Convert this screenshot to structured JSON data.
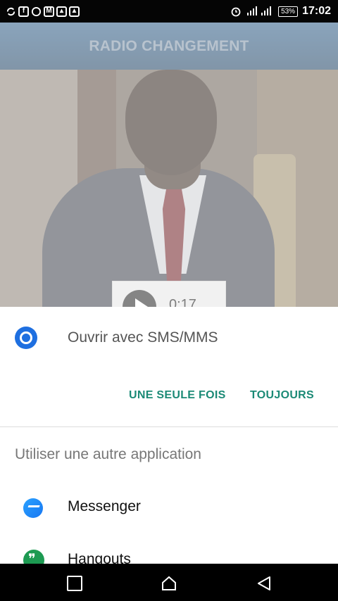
{
  "status_bar": {
    "notification_icons": [
      "sync-icon",
      "facebook-icon",
      "whatsapp-icon",
      "gmail-icon",
      "image-icon",
      "alert-icon"
    ],
    "battery": "53%",
    "time": "17:02"
  },
  "app": {
    "title": "RADIO CHANGEMENT"
  },
  "video": {
    "duration": "0:17"
  },
  "sheet": {
    "open_with_label": "Ouvrir avec SMS/MMS",
    "button_once": "UNE SEULE FOIS",
    "button_always": "TOUJOURS",
    "other_app_label": "Utiliser une autre application",
    "apps": [
      {
        "label": "Messenger",
        "icon": "messenger-icon"
      },
      {
        "label": "Hangouts",
        "icon": "hangouts-icon"
      }
    ]
  },
  "colors": {
    "accent": "#1b8a76",
    "appbar": "#1b3f61",
    "sms_icon": "#1e6fe0"
  }
}
